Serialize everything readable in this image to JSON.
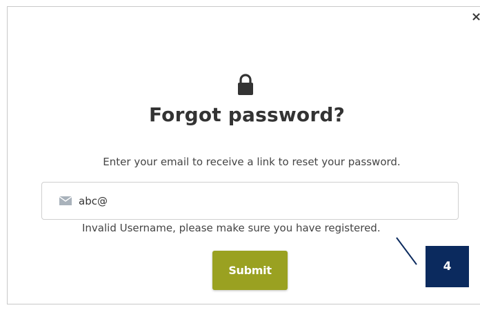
{
  "dialog": {
    "close_glyph": "×",
    "title": "Forgot password?",
    "description": "Enter your email to receive a link to reset your password.",
    "email_field": {
      "value": "abc@",
      "icon": "envelope-icon"
    },
    "error_message": "Invalid Username, please make sure you have registered.",
    "submit_label": "Submit",
    "lock_icon": "lock-icon"
  },
  "annotation": {
    "callout_number": "4"
  },
  "colors": {
    "submit": "#9aa121",
    "callout": "#0b2a5e",
    "text": "#333333"
  }
}
